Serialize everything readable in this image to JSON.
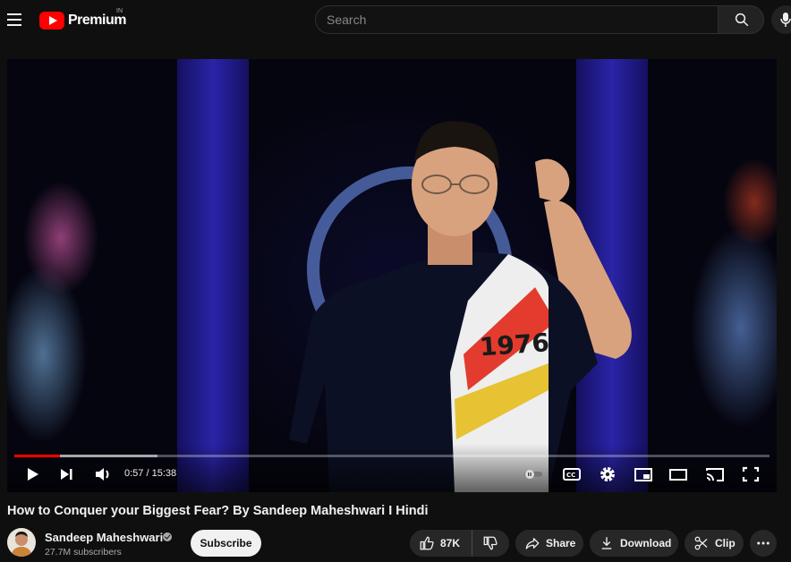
{
  "header": {
    "logo_text": "Premium",
    "region": "IN",
    "search_placeholder": "Search"
  },
  "player": {
    "current_time": "0:57",
    "duration": "15:38",
    "time_separator": "/",
    "progress_fraction": 0.061,
    "buffered_fraction": 0.19,
    "shirt_number": "1976"
  },
  "video": {
    "title": "How to Conquer your Biggest Fear? By Sandeep Maheshwari I Hindi"
  },
  "channel": {
    "name": "Sandeep Maheshwari",
    "subscribers": "27.7M subscribers",
    "subscribe_label": "Subscribe"
  },
  "actions": {
    "like_count": "87K",
    "share_label": "Share",
    "download_label": "Download",
    "clip_label": "Clip"
  },
  "colors": {
    "accent": "#ff0000",
    "background": "#0f0f0f",
    "pill_bg": "#272727"
  }
}
